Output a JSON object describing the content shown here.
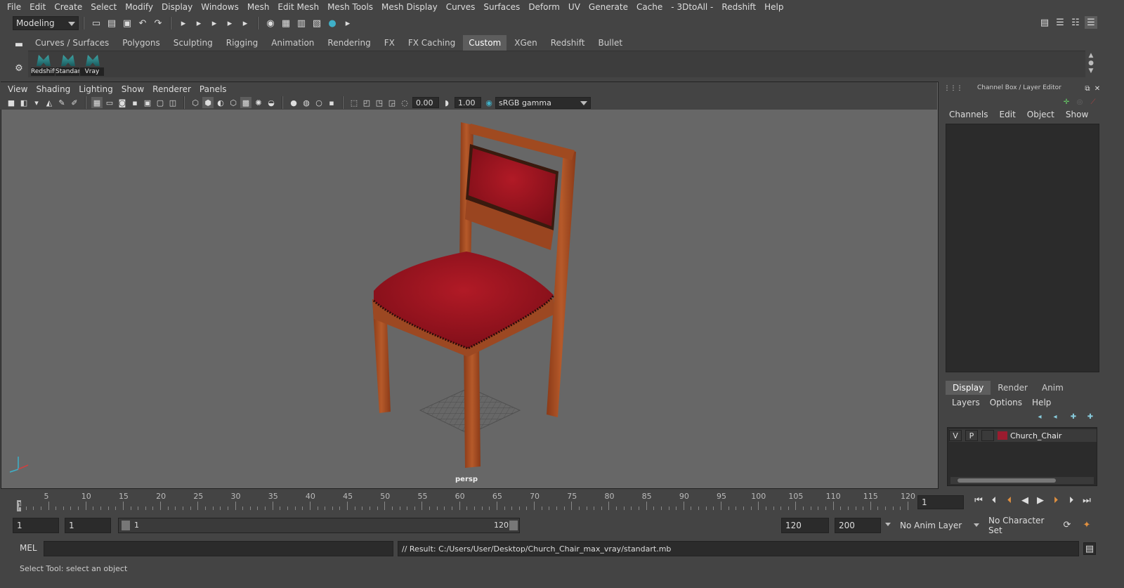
{
  "menu": [
    "File",
    "Edit",
    "Create",
    "Select",
    "Modify",
    "Display",
    "Windows",
    "Mesh",
    "Edit Mesh",
    "Mesh Tools",
    "Mesh Display",
    "Curves",
    "Surfaces",
    "Deform",
    "UV",
    "Generate",
    "Cache",
    "- 3DtoAll -",
    "Redshift",
    "Help"
  ],
  "mode": "Modeling",
  "shelf_tabs": [
    "Curves / Surfaces",
    "Polygons",
    "Sculpting",
    "Rigging",
    "Animation",
    "Rendering",
    "FX",
    "FX Caching",
    "Custom",
    "XGen",
    "Redshift",
    "Bullet"
  ],
  "shelf_active": "Custom",
  "shelf_buttons": [
    "Redshift",
    "Standard",
    "Vray"
  ],
  "viewport": {
    "menu": [
      "View",
      "Shading",
      "Lighting",
      "Show",
      "Renderer",
      "Panels"
    ],
    "exposure": "0.00",
    "gamma": "1.00",
    "colorspace": "sRGB gamma",
    "camera": "persp"
  },
  "channel_box": {
    "title": "Channel Box / Layer Editor",
    "menu": [
      "Channels",
      "Edit",
      "Object",
      "Show"
    ]
  },
  "layer_editor": {
    "tabs": [
      "Display",
      "Render",
      "Anim"
    ],
    "menu": [
      "Layers",
      "Options",
      "Help"
    ],
    "layers": [
      {
        "v": "V",
        "p": "P",
        "name": "Church_Chair",
        "color": "#9b1c2f"
      }
    ]
  },
  "timeline": {
    "ticks": [
      5,
      10,
      15,
      20,
      25,
      30,
      35,
      40,
      45,
      50,
      55,
      60,
      65,
      70,
      75,
      80,
      85,
      90,
      95,
      100,
      105,
      110,
      115,
      120
    ],
    "start_label": "1",
    "current_frame": "1"
  },
  "range": {
    "start": "1",
    "playback_start": "1",
    "slider_start": "1",
    "slider_end": "120",
    "playback_end": "120",
    "end": "200",
    "anim_layer": "No Anim Layer",
    "character_set": "No Character Set"
  },
  "command": {
    "lang": "MEL",
    "result": "// Result: C:/Users/User/Desktop/Church_Chair_max_vray/standart.mb"
  },
  "status": "Select Tool: select an object"
}
